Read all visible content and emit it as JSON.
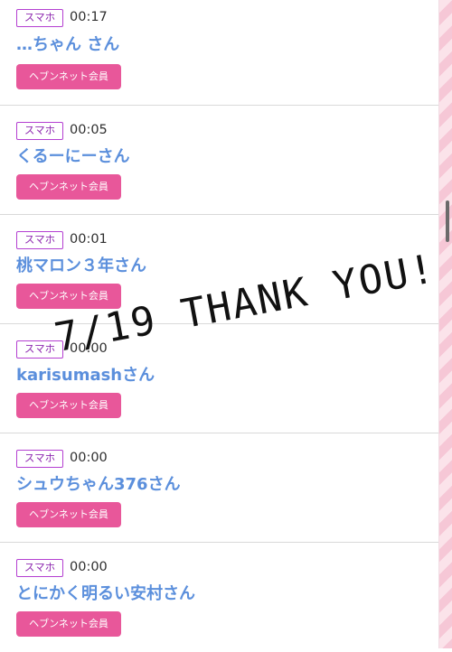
{
  "rows": [
    {
      "badge": "スマホ",
      "time": "00:17",
      "name": "…ちゃん さん",
      "member": "ヘブンネット会員"
    },
    {
      "badge": "スマホ",
      "time": "00:05",
      "name": "くるーにーさん",
      "member": "ヘブンネット会員"
    },
    {
      "badge": "スマホ",
      "time": "00:01",
      "name": "桃マロン３年さん",
      "member": "ヘブンネット会員"
    },
    {
      "badge": "スマホ",
      "time": "00:00",
      "name": "karisumashさん",
      "member": "ヘブンネット会員"
    },
    {
      "badge": "スマホ",
      "time": "00:00",
      "name": "シュウちゃん376さん",
      "member": "ヘブンネット会員"
    },
    {
      "badge": "スマホ",
      "time": "00:00",
      "name": "とにかく明るい安村さん",
      "member": "ヘブンネット会員"
    }
  ],
  "overlay_text": "7/19 THANK YOU!",
  "colors": {
    "badge_border": "#b43fd1",
    "name": "#5b8fdc",
    "member_button": "#e8579a"
  }
}
